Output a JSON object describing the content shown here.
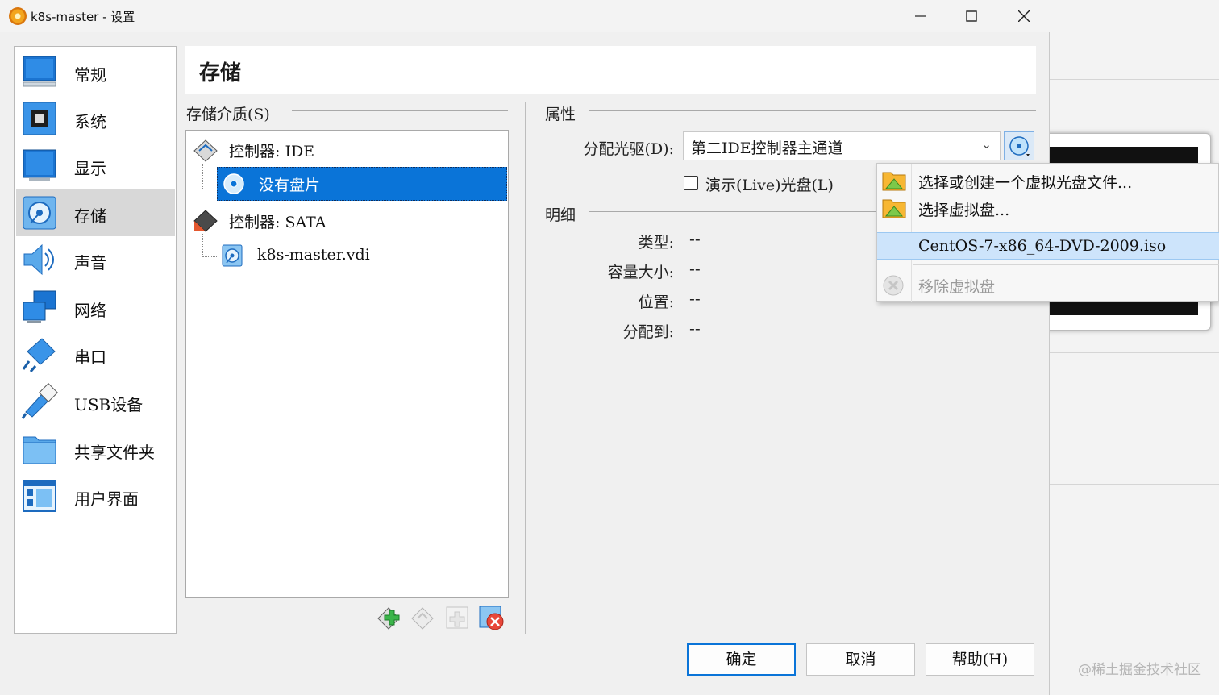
{
  "window": {
    "title": "k8s-master - 设置"
  },
  "sidebar": {
    "items": [
      {
        "label": "常规",
        "icon": "general-icon"
      },
      {
        "label": "系统",
        "icon": "system-icon"
      },
      {
        "label": "显示",
        "icon": "display-icon"
      },
      {
        "label": "存储",
        "icon": "storage-icon",
        "active": true
      },
      {
        "label": "声音",
        "icon": "audio-icon"
      },
      {
        "label": "网络",
        "icon": "network-icon"
      },
      {
        "label": "串口",
        "icon": "serial-port-icon"
      },
      {
        "label": "USB设备",
        "icon": "usb-icon"
      },
      {
        "label": "共享文件夹",
        "icon": "shared-folder-icon"
      },
      {
        "label": "用户界面",
        "icon": "user-interface-icon"
      }
    ]
  },
  "header": {
    "title": "存储"
  },
  "storage": {
    "section_label": "存储介质(S)",
    "tree": {
      "controller_ide": "控制器: IDE",
      "ide_item": "没有盘片",
      "controller_sata": "控制器: SATA",
      "sata_item": "k8s-master.vdi"
    }
  },
  "properties": {
    "section_label": "属性",
    "drive_label": "分配光驱(D):",
    "drive_value": "第二IDE控制器主通道",
    "live_cd_label": "演示(Live)光盘(L)",
    "live_cd_checked": false
  },
  "details": {
    "section_label": "明细",
    "type_label": "类型:",
    "type_value": "--",
    "size_label": "容量大小:",
    "size_value": "--",
    "location_label": "位置:",
    "location_value": "--",
    "attached_label": "分配到:",
    "attached_value": "--"
  },
  "menu": {
    "items": [
      {
        "label": "选择或创建一个虚拟光盘文件..."
      },
      {
        "label": "选择虚拟盘..."
      },
      {
        "label": "CentOS-7-x86_64-DVD-2009.iso",
        "highlighted": true
      },
      {
        "label": "移除虚拟盘",
        "disabled": true
      }
    ]
  },
  "buttons": {
    "ok": "确定",
    "cancel": "取消",
    "help": "帮助(H)"
  },
  "watermark": "@稀土掘金技术社区",
  "colors": {
    "accent": "#0a74d8",
    "menu_highlight": "#cde4fb"
  }
}
